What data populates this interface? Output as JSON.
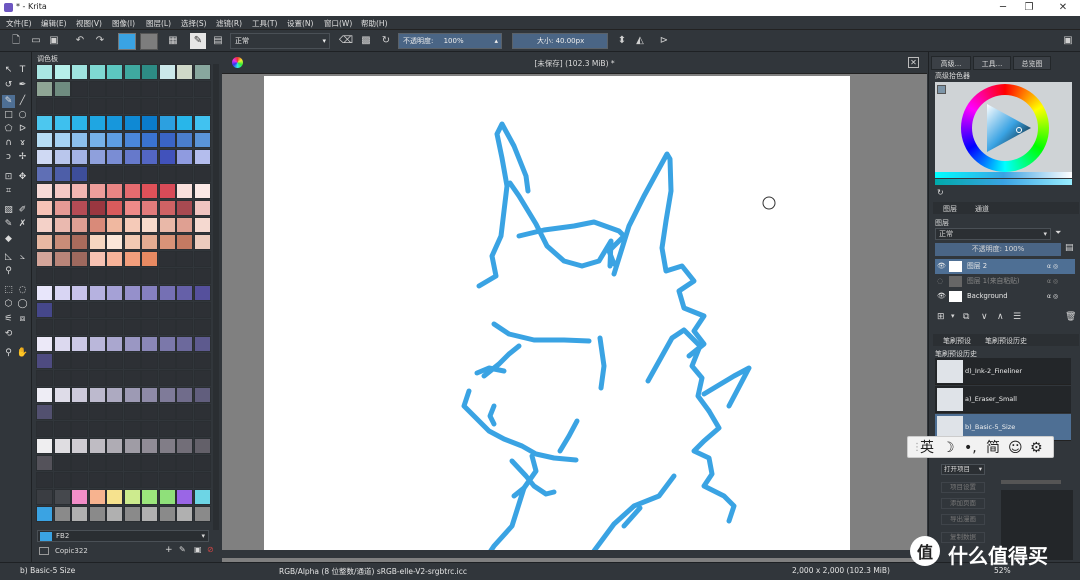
{
  "window": {
    "title": "* - Krita"
  },
  "menu": [
    "文件(E)",
    "编辑(E)",
    "视图(V)",
    "图像(I)",
    "图层(L)",
    "选择(S)",
    "滤镜(R)",
    "工具(T)",
    "设置(N)",
    "窗口(W)",
    "帮助(H)"
  ],
  "toolbar": {
    "blend_mode": "正常",
    "opacity_label": "不透明度:",
    "opacity_value": "100%",
    "size_label": "大小:",
    "size_value": "40.00px"
  },
  "palette": {
    "header": "调色板",
    "name_field": "FB2",
    "palette_name": "Copic322"
  },
  "document": {
    "tab_title": "[未保存] (102.3 MiB) *"
  },
  "right_panel": {
    "tabs": [
      "高级...",
      "工具...",
      "总览图"
    ],
    "color_selector_label": "高级拾色器",
    "layer_tabs": [
      "图层",
      "通道"
    ],
    "layers_label": "图层",
    "layer_blend": "正常",
    "layer_opacity": "不透明度: 100%",
    "layers": [
      {
        "name": "图层 2",
        "selected": true
      },
      {
        "name": "图层 1(来自粘贴)",
        "selected": false
      },
      {
        "name": "Background",
        "selected": false
      }
    ],
    "preset_tabs": [
      "笔刷预设",
      "笔刷预设历史"
    ],
    "preset_history_label": "笔刷预设历史",
    "brushes": [
      "d)_Ink-2_Fineliner",
      "a)_Eraser_Small",
      "b)_Basic-5_Size"
    ],
    "open_item": "打开项目",
    "disabled_buttons": [
      "项目设置",
      "添加页面",
      "导出漫画",
      "复制数据"
    ]
  },
  "ime": {
    "lang": "英",
    "simplified": "简"
  },
  "status": {
    "brush": "b) Basic-5 Size",
    "colorspace": "RGB/Alpha (8 位整数/通道)  sRGB-elle-V2-srgbtrc.icc",
    "size": "2,000 x 2,000 (102.3 MiB)",
    "zoom": "52%"
  },
  "watermark": {
    "text": "什么值得买"
  },
  "colors": {
    "stroke": "#3aa3e3",
    "selected_layer": "#4e6f94",
    "panel": "#31363b"
  }
}
